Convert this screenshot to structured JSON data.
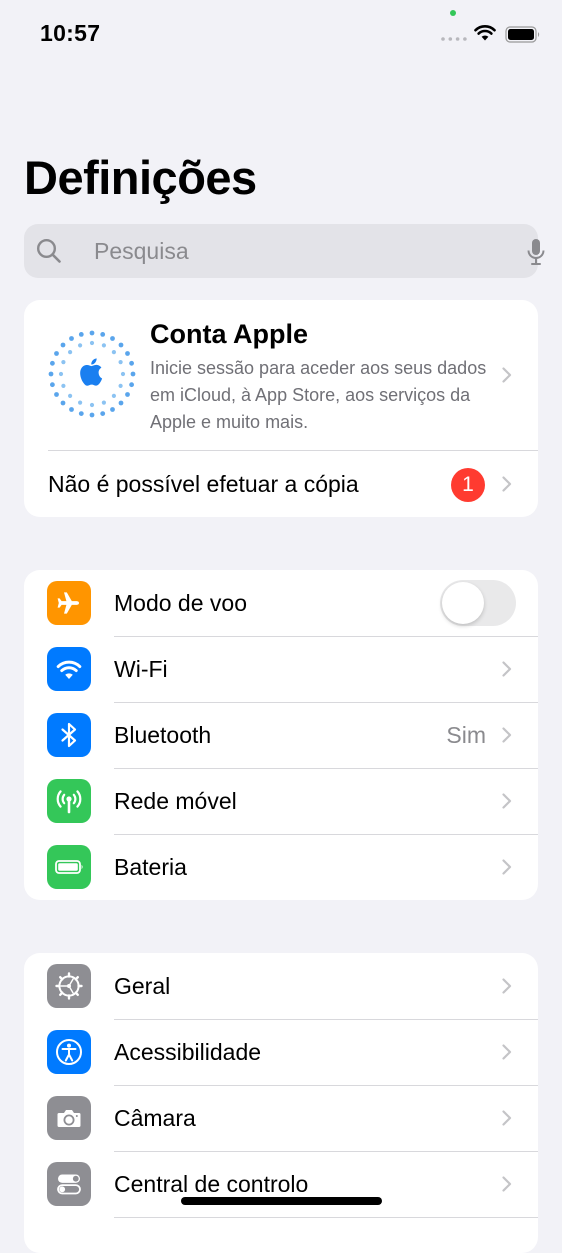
{
  "status_bar": {
    "time": "10:57",
    "signal_icon": "cellular-dots-icon",
    "wifi_icon": "wifi-icon",
    "battery_icon": "battery-icon",
    "camera_indicator_color": "#34c759"
  },
  "header": {
    "title": "Definições"
  },
  "search": {
    "placeholder": "Pesquisa",
    "value": "",
    "mic_icon": "microphone-icon"
  },
  "account": {
    "name": "Conta Apple",
    "description": "Inicie sessão para aceder aos seus dados em iCloud, à App Store, aos serviços da Apple e muito mais.",
    "avatar_icon": "apple-logo-icon",
    "backup_label": "Não é possível efetuar a cópia",
    "badge_count": "1",
    "badge_color": "#ff3b30"
  },
  "connectivity": {
    "items": [
      {
        "label": "Modo de voo",
        "icon": "airplane-icon",
        "color": "#ff9500",
        "toggle": false
      },
      {
        "label": "Wi-Fi",
        "icon": "wifi-icon",
        "color": "#007aff"
      },
      {
        "label": "Bluetooth",
        "icon": "bluetooth-icon",
        "color": "#007aff",
        "value": "Sim"
      },
      {
        "label": "Rede móvel",
        "icon": "antenna-icon",
        "color": "#34c759"
      },
      {
        "label": "Bateria",
        "icon": "battery-icon",
        "color": "#34c759"
      }
    ]
  },
  "general": {
    "items": [
      {
        "label": "Geral",
        "icon": "gear-icon",
        "color": "#8e8e93"
      },
      {
        "label": "Acessibilidade",
        "icon": "accessibility-icon",
        "color": "#007aff"
      },
      {
        "label": "Câmara",
        "icon": "camera-icon",
        "color": "#8e8e93"
      },
      {
        "label": "Central de controlo",
        "icon": "switches-icon",
        "color": "#8e8e93"
      }
    ]
  }
}
